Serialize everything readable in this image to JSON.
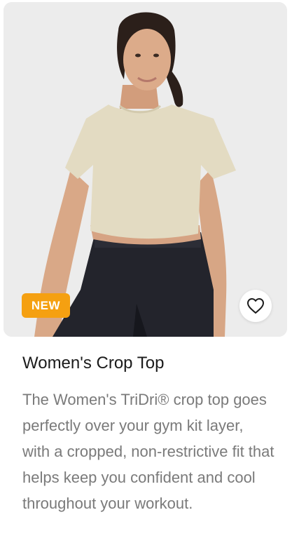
{
  "product": {
    "badge": "NEW",
    "title": "Women's Crop Top",
    "description": "The Women's TriDri® crop top goes perfectly over your gym kit layer, with a cropped, non-restrictive fit that helps keep you confident and cool throughout your workout.",
    "image_alt": "Model wearing a sand-coloured cropped t-shirt and black leggings"
  },
  "icons": {
    "wishlist": "heart-outline-icon"
  },
  "colors": {
    "badge_bg": "#f5a011",
    "badge_text": "#ffffff",
    "title": "#1b1b1b",
    "description": "#7a7a7a",
    "image_bg": "#ececec",
    "shirt": "#e3dbc2",
    "leggings": "#23242c"
  }
}
